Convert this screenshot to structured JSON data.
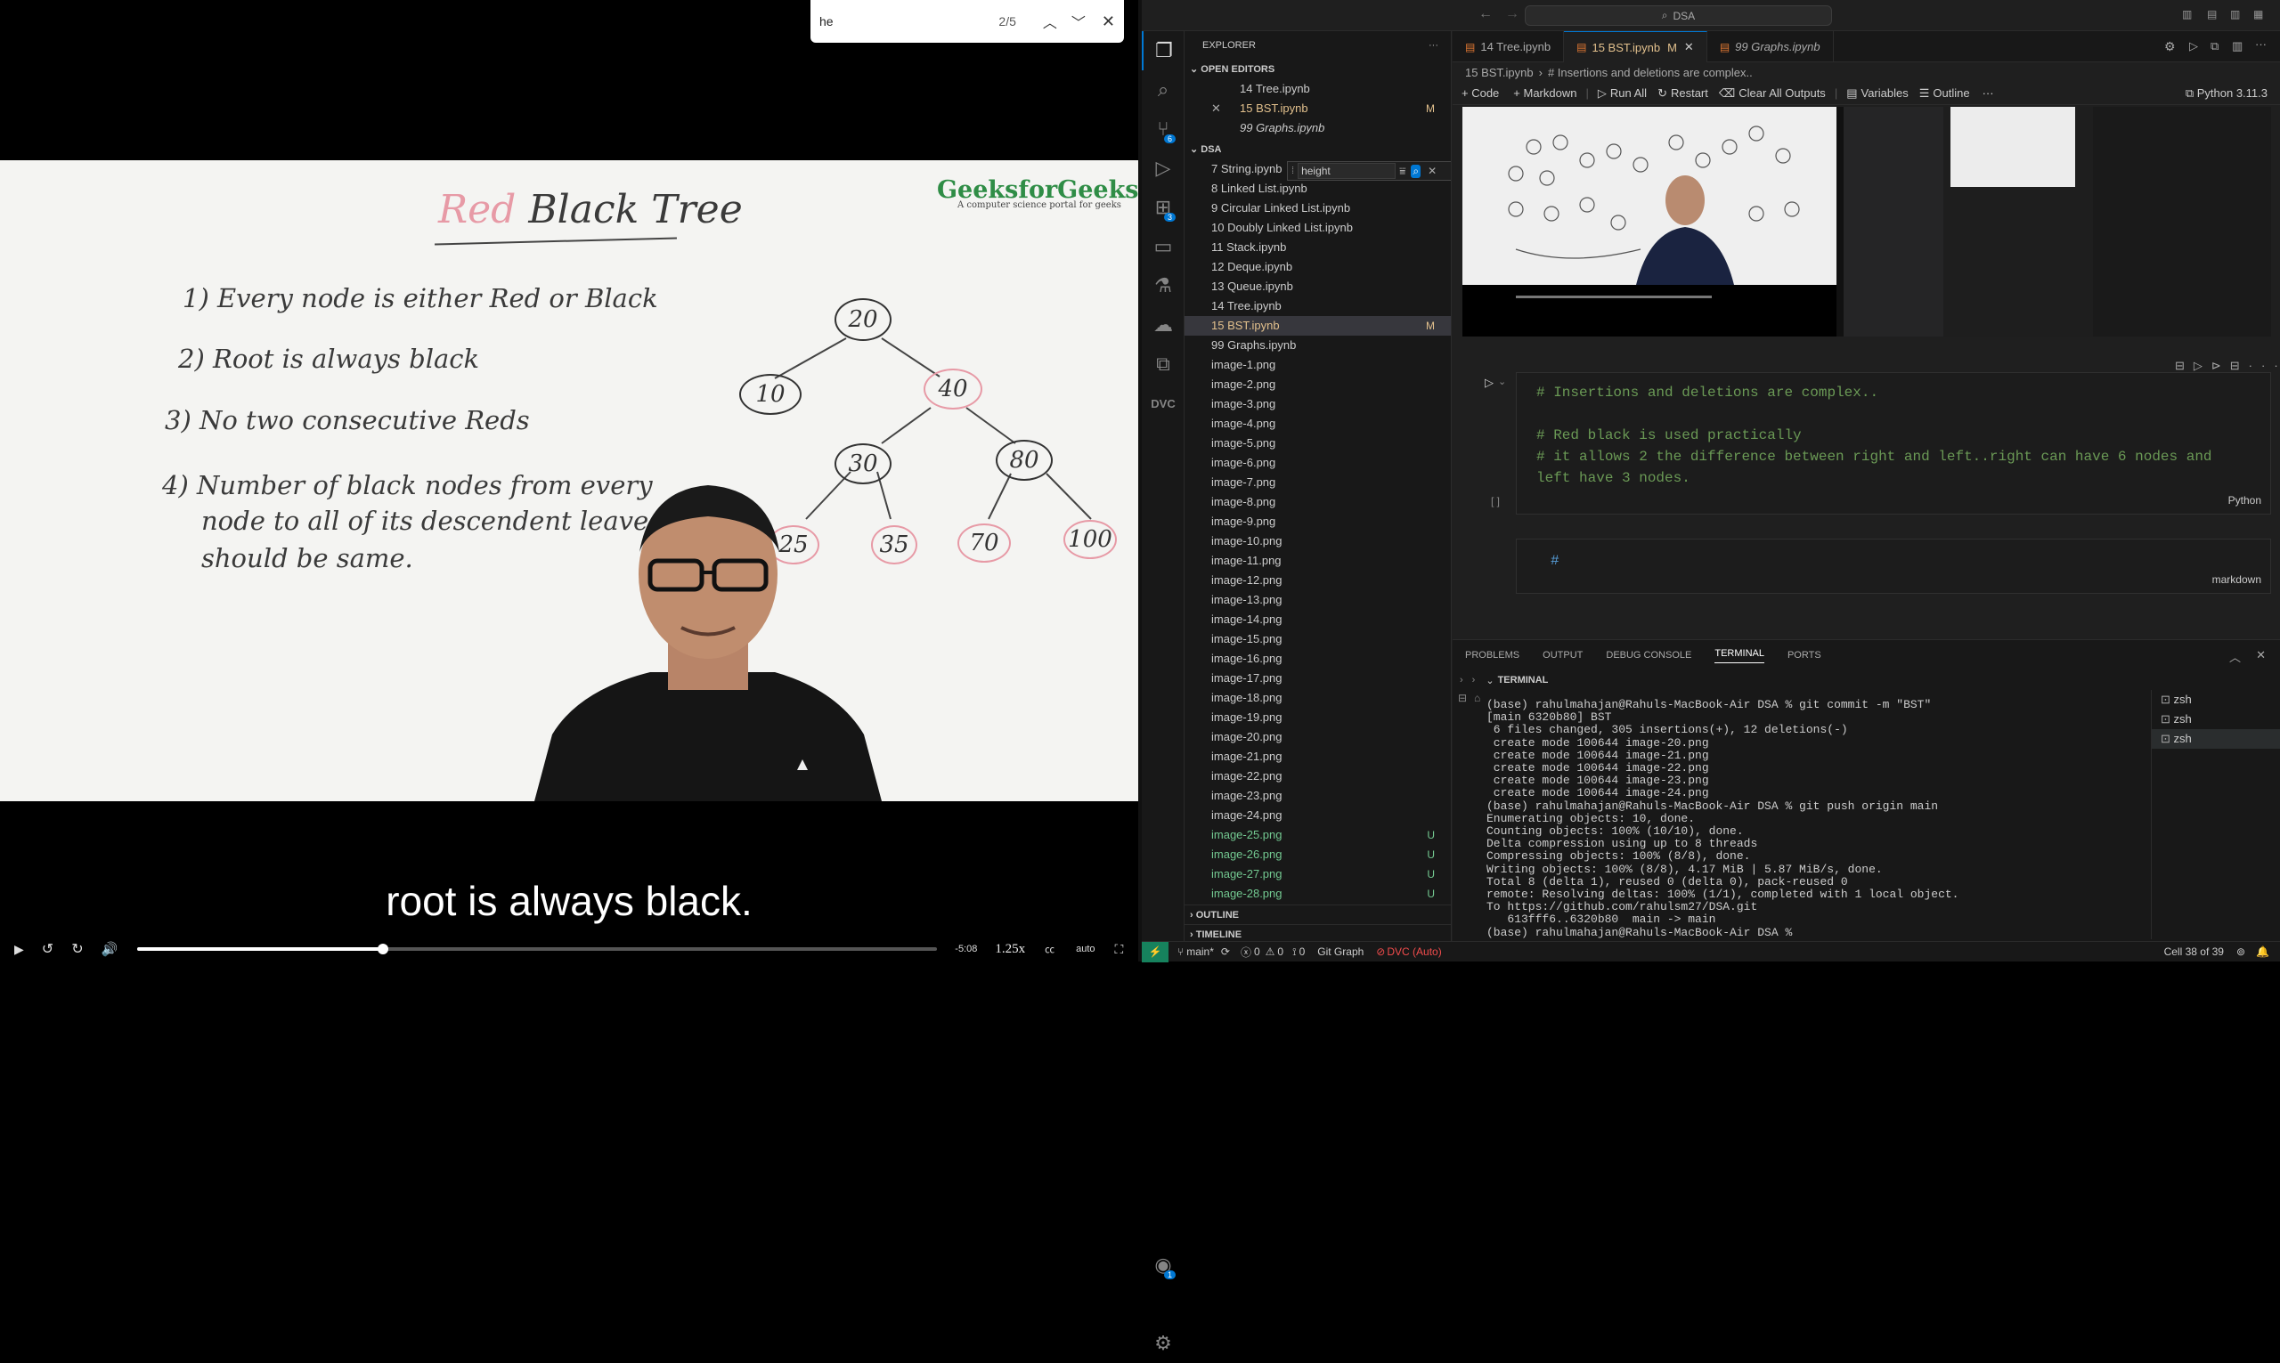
{
  "find": {
    "value": "he",
    "count": "2/5"
  },
  "video": {
    "title_red": "Red",
    "title_black": "Black Tree",
    "brand": "GeeksforGeeks",
    "brand_sub": "A computer science portal for geeks",
    "rules": [
      "1)  Every node is either Red or Black",
      "2)  Root is always black",
      "3)  No two consecutive Reds",
      "4)  Number of black nodes from every",
      "node to all of its descendent leaves",
      "should be same."
    ],
    "nodes": [
      "20",
      "10",
      "40",
      "30",
      "80",
      "25",
      "35",
      "70",
      "100"
    ],
    "subtitle": "root is always black.",
    "time": "-5:08",
    "speed": "1.25x",
    "quality": "auto",
    "progress": 0.307
  },
  "vscode": {
    "search": "DSA",
    "explorer_title": "EXPLORER",
    "open_editors_title": "OPEN EDITORS",
    "open_editors": [
      {
        "name": "14 Tree.ipynb",
        "badge": ""
      },
      {
        "name": "15 BST.ipynb",
        "badge": "M"
      },
      {
        "name": "99 Graphs.ipynb",
        "badge": ""
      }
    ],
    "folder": "DSA",
    "files": [
      {
        "name": "7 String.ipynb",
        "badge": ""
      },
      {
        "name": "8 Linked List.ipynb",
        "badge": ""
      },
      {
        "name": "9 Circular Linked List.ipynb",
        "badge": ""
      },
      {
        "name": "10 Doubly Linked List.ipynb",
        "badge": ""
      },
      {
        "name": "11 Stack.ipynb",
        "badge": ""
      },
      {
        "name": "12 Deque.ipynb",
        "badge": ""
      },
      {
        "name": "13 Queue.ipynb",
        "badge": ""
      },
      {
        "name": "14 Tree.ipynb",
        "badge": ""
      },
      {
        "name": "15 BST.ipynb",
        "badge": "M"
      },
      {
        "name": "99 Graphs.ipynb",
        "badge": ""
      },
      {
        "name": "image-1.png",
        "badge": ""
      },
      {
        "name": "image-2.png",
        "badge": ""
      },
      {
        "name": "image-3.png",
        "badge": ""
      },
      {
        "name": "image-4.png",
        "badge": ""
      },
      {
        "name": "image-5.png",
        "badge": ""
      },
      {
        "name": "image-6.png",
        "badge": ""
      },
      {
        "name": "image-7.png",
        "badge": ""
      },
      {
        "name": "image-8.png",
        "badge": ""
      },
      {
        "name": "image-9.png",
        "badge": ""
      },
      {
        "name": "image-10.png",
        "badge": ""
      },
      {
        "name": "image-11.png",
        "badge": ""
      },
      {
        "name": "image-12.png",
        "badge": ""
      },
      {
        "name": "image-13.png",
        "badge": ""
      },
      {
        "name": "image-14.png",
        "badge": ""
      },
      {
        "name": "image-15.png",
        "badge": ""
      },
      {
        "name": "image-16.png",
        "badge": ""
      },
      {
        "name": "image-17.png",
        "badge": ""
      },
      {
        "name": "image-18.png",
        "badge": ""
      },
      {
        "name": "image-19.png",
        "badge": ""
      },
      {
        "name": "image-20.png",
        "badge": ""
      },
      {
        "name": "image-21.png",
        "badge": ""
      },
      {
        "name": "image-22.png",
        "badge": ""
      },
      {
        "name": "image-23.png",
        "badge": ""
      },
      {
        "name": "image-24.png",
        "badge": ""
      },
      {
        "name": "image-25.png",
        "badge": "U"
      },
      {
        "name": "image-26.png",
        "badge": "U"
      },
      {
        "name": "image-27.png",
        "badge": "U"
      },
      {
        "name": "image-28.png",
        "badge": "U"
      }
    ],
    "filter": {
      "value": "height"
    },
    "outline": "OUTLINE",
    "timeline": "TIMELINE",
    "tabs": [
      {
        "name": "14 Tree.ipynb",
        "mod": ""
      },
      {
        "name": "15 BST.ipynb",
        "mod": "M"
      },
      {
        "name": "99 Graphs.ipynb",
        "mod": ""
      }
    ],
    "breadcrumb": [
      "15 BST.ipynb",
      "# Insertions and deletions are complex.."
    ],
    "toolbar": [
      "+ Code",
      "+ Markdown",
      "Run All",
      "Restart",
      "Clear All Outputs",
      "Variables",
      "Outline"
    ],
    "kernel": "Python 3.11.3",
    "cell1_lines": [
      "# Insertions and deletions are complex..",
      "",
      "# Red black is used practically",
      "# it allows 2 the difference between right and left..right can have 6 nodes and",
      "left have 3 nodes."
    ],
    "cell1_lang": "Python",
    "cell1_exec": "[ ]",
    "cell2_line": "#",
    "cell2_lang": "markdown",
    "panel_tabs": [
      "PROBLEMS",
      "OUTPUT",
      "DEBUG CONSOLE",
      "TERMINAL",
      "PORTS"
    ],
    "terminal_title": "TERMINAL",
    "terminal": [
      "(base) rahulmahajan@Rahuls-MacBook-Air DSA % git commit -m \"BST\"",
      "[main 6320b80] BST",
      " 6 files changed, 305 insertions(+), 12 deletions(-)",
      " create mode 100644 image-20.png",
      " create mode 100644 image-21.png",
      " create mode 100644 image-22.png",
      " create mode 100644 image-23.png",
      " create mode 100644 image-24.png",
      "(base) rahulmahajan@Rahuls-MacBook-Air DSA % git push origin main",
      "Enumerating objects: 10, done.",
      "Counting objects: 100% (10/10), done.",
      "Delta compression using up to 8 threads",
      "Compressing objects: 100% (8/8), done.",
      "Writing objects: 100% (8/8), 4.17 MiB | 5.87 MiB/s, done.",
      "Total 8 (delta 1), reused 0 (delta 0), pack-reused 0",
      "remote: Resolving deltas: 100% (1/1), completed with 1 local object.",
      "To https://github.com/rahulsm27/DSA.git",
      "   613fff6..6320b80  main -> main",
      "(base) rahulmahajan@Rahuls-MacBook-Air DSA % "
    ],
    "shells": [
      "zsh",
      "zsh",
      "zsh"
    ],
    "status": {
      "branch": "main*",
      "errors": "0",
      "warnings": "0",
      "ports": "0",
      "git_graph": "Git Graph",
      "dvc": "DVC (Auto)",
      "cell": "Cell 38 of 39"
    },
    "badges": {
      "scm": "6",
      "ext": "3",
      "account": "1"
    },
    "colors": {
      "modified": "#e2c08d",
      "untracked": "#73c991",
      "accent": "#0078d4",
      "status_bar": "#16825d",
      "dvc": "#f14c4c"
    }
  }
}
